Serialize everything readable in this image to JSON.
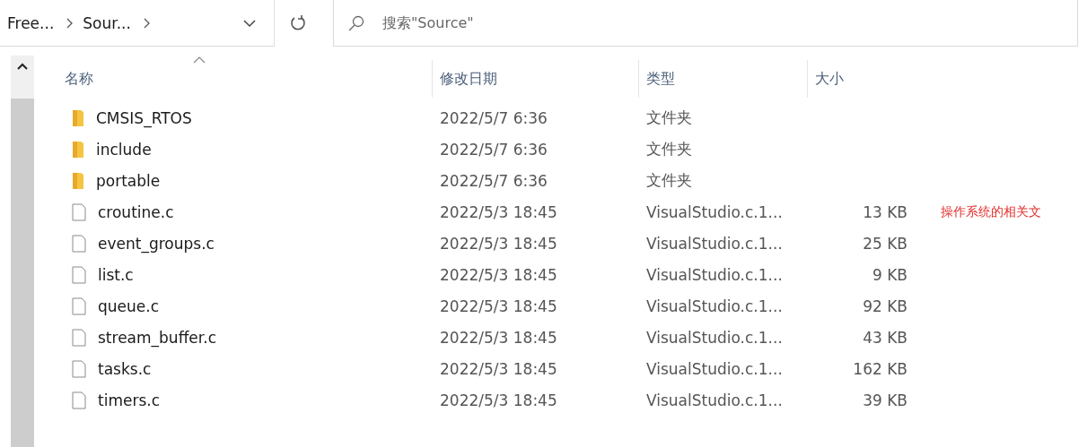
{
  "breadcrumb": [
    {
      "label": "Free..."
    },
    {
      "label": "Sour..."
    }
  ],
  "search": {
    "placeholder": "搜索\"Source\""
  },
  "columns": [
    {
      "label": "名称",
      "sorted": true
    },
    {
      "label": "修改日期",
      "sorted": false
    },
    {
      "label": "类型",
      "sorted": false
    },
    {
      "label": "大小",
      "sorted": false
    }
  ],
  "rows": [
    {
      "kind": "folder",
      "name": "CMSIS_RTOS",
      "date": "2022/5/7 6:36",
      "type": "文件夹"
    },
    {
      "kind": "folder",
      "name": "include",
      "date": "2022/5/7 6:36",
      "type": "文件夹"
    },
    {
      "kind": "folder",
      "name": "portable",
      "date": "2022/5/7 6:36",
      "type": "文件夹"
    },
    {
      "kind": "file",
      "name": "croutine.c",
      "date": "2022/5/3 18:45",
      "type": "VisualStudio.c.1...",
      "size": "13 KB",
      "note": "操作系统的相关文"
    },
    {
      "kind": "file",
      "name": "event_groups.c",
      "date": "2022/5/3 18:45",
      "type": "VisualStudio.c.1...",
      "size": "25 KB"
    },
    {
      "kind": "file",
      "name": "list.c",
      "date": "2022/5/3 18:45",
      "type": "VisualStudio.c.1...",
      "size": "9 KB"
    },
    {
      "kind": "file",
      "name": "queue.c",
      "date": "2022/5/3 18:45",
      "type": "VisualStudio.c.1...",
      "size": "92 KB"
    },
    {
      "kind": "file",
      "name": "stream_buffer.c",
      "date": "2022/5/3 18:45",
      "type": "VisualStudio.c.1...",
      "size": "43 KB"
    },
    {
      "kind": "file",
      "name": "tasks.c",
      "date": "2022/5/3 18:45",
      "type": "VisualStudio.c.1...",
      "size": "162 KB"
    },
    {
      "kind": "file",
      "name": "timers.c",
      "date": "2022/5/3 18:45",
      "type": "VisualStudio.c.1...",
      "size": "39 KB"
    }
  ]
}
